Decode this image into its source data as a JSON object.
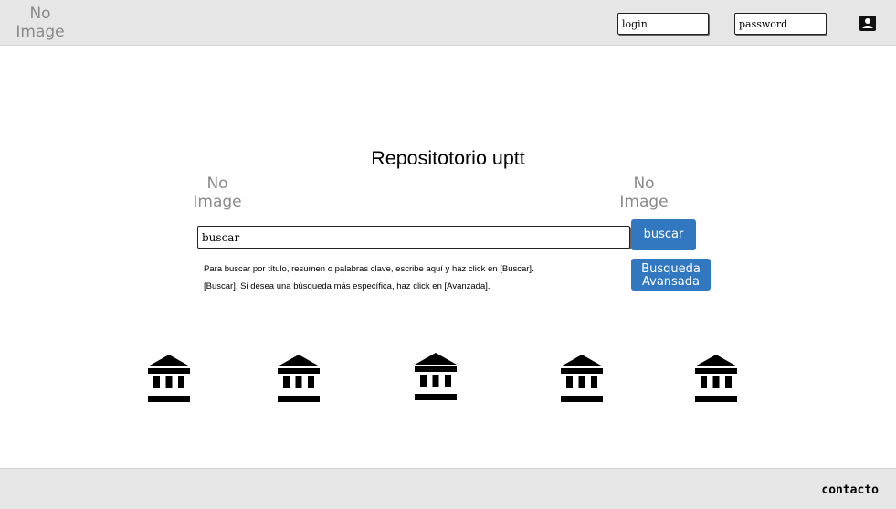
{
  "header": {
    "logo": {
      "line1": "No",
      "line2": "Image"
    },
    "login_value": "login",
    "password_value": "password",
    "user_icon": "user-card-icon"
  },
  "main": {
    "title": "Repositotorio uptt",
    "left_image": {
      "line1": "No",
      "line2": "Image"
    },
    "right_image": {
      "line1": "No",
      "line2": "Image"
    },
    "search_value": "buscar",
    "search_button": "buscar",
    "advanced_button": {
      "line1": "Busqueda",
      "line2": "Avansada"
    },
    "hint_lines": [
      "Para buscar por título, resumen o palabras clave, escribe aquí y haz click en [Buscar].",
      "[Buscar]. Si desea una búsqueda más específica, haz click en [Avanzada]."
    ],
    "institution_icons": [
      "institution-icon",
      "institution-icon",
      "institution-icon",
      "institution-icon",
      "institution-icon"
    ]
  },
  "footer": {
    "contact_label": "contacto"
  },
  "colors": {
    "bar_bg": "#e6e6e6",
    "button_blue": "#3178c0"
  }
}
